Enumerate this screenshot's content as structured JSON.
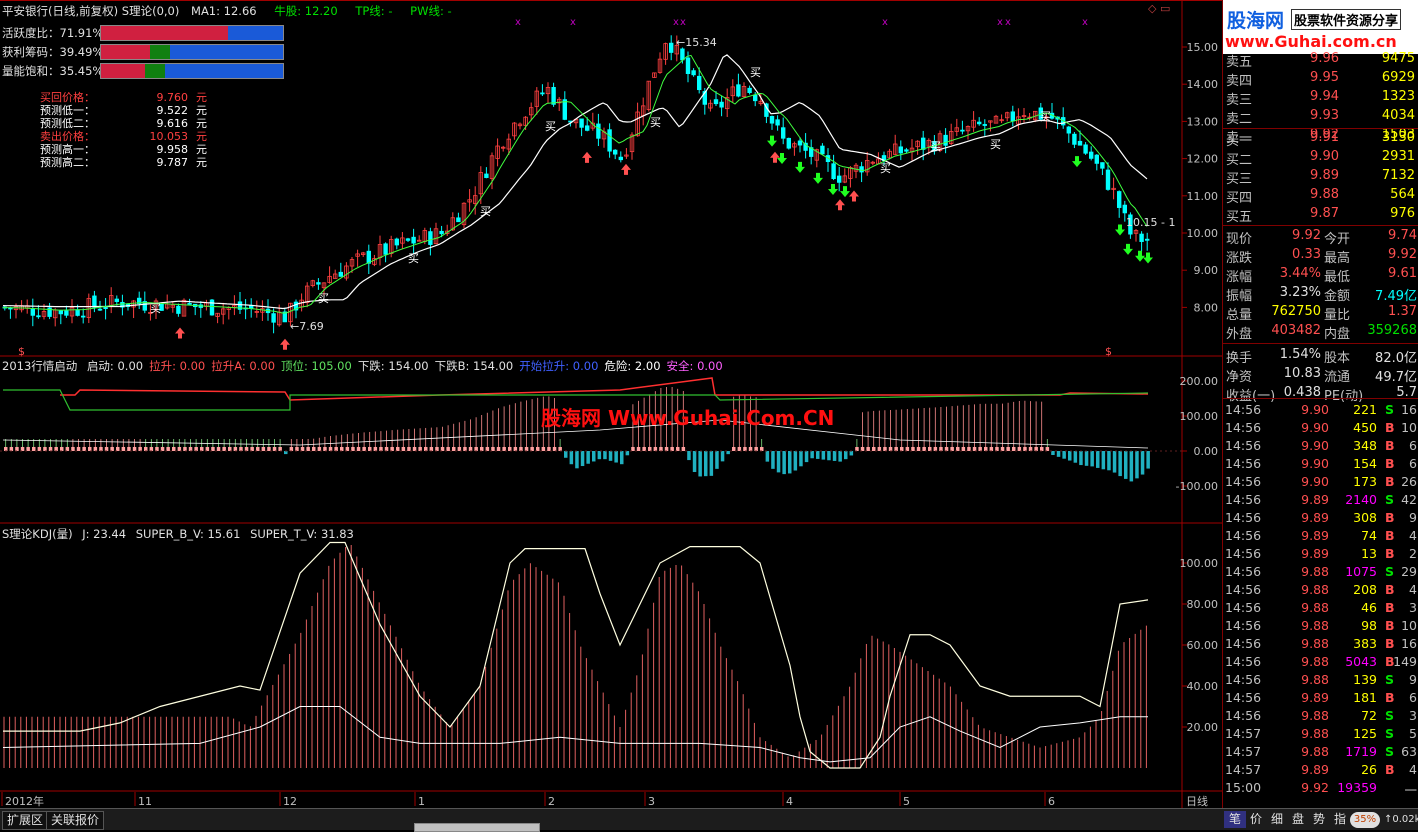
{
  "main_header": {
    "title": "平安银行(日线,前复权) S理论(0,0)",
    "ma": "MA1: 12.66",
    "niugu": "牛股: 12.20",
    "tp": "TP线: -",
    "pw": "PW线: -"
  },
  "indicators": [
    {
      "label": "活跃度比：71.91%",
      "fill": 0.7
    },
    {
      "label": "获利筹码：39.49%",
      "fill": 0.38
    },
    {
      "label": "量能饱和：35.45%",
      "fill": 0.35
    }
  ],
  "predictions": [
    {
      "label": "买回价格：",
      "value": "9.760",
      "unit": "元",
      "color": "#ff4040"
    },
    {
      "label": "预测低一：",
      "value": "9.522",
      "unit": "元",
      "color": "#ffffff"
    },
    {
      "label": "预测低二：",
      "value": "9.616",
      "unit": "元",
      "color": "#ffffff"
    },
    {
      "label": "卖出价格：",
      "value": "10.053",
      "unit": "元",
      "color": "#ff4040"
    },
    {
      "label": "预测高一：",
      "value": "9.958",
      "unit": "元",
      "color": "#ffffff"
    },
    {
      "label": "预测高二：",
      "value": "9.787",
      "unit": "元",
      "color": "#ffffff"
    }
  ],
  "main_axis": [
    "15.00",
    "14.00",
    "13.00",
    "12.00",
    "11.00",
    "10.00",
    "9.00",
    "8.00"
  ],
  "annotations": {
    "high": "15.34",
    "low": "7.69",
    "last": "10.15",
    "buy": "买",
    "sell": "$",
    "kmark": "x"
  },
  "panel2_header": {
    "name": "2013行情启动",
    "items": [
      {
        "text": "启动: 0.00",
        "color": "#e0e0e0"
      },
      {
        "text": "拉升: 0.00",
        "color": "#ff5050"
      },
      {
        "text": "拉升A: 0.00",
        "color": "#ff5050"
      },
      {
        "text": "顶位: 105.00",
        "color": "#60e060"
      },
      {
        "text": "下跌: 154.00",
        "color": "#e0e0e0"
      },
      {
        "text": "下跌B: 154.00",
        "color": "#e0e0e0"
      },
      {
        "text": "开始拉升: 0.00",
        "color": "#4060ff"
      },
      {
        "text": "危险: 2.00",
        "color": "#ffffff"
      },
      {
        "text": "安全: 0.00",
        "color": "#ff60ff"
      }
    ]
  },
  "panel2_axis": [
    "200.00",
    "100.00",
    "0.00",
    "-100.00"
  ],
  "watermark": "股海网 Www.Guhai.Com.CN",
  "panel3_header": {
    "name": "S理论KDJ(量)",
    "j": "J: 23.44",
    "b": "SUPER_B_V: 15.61",
    "t": "SUPER_T_V: 31.83"
  },
  "panel3_axis": [
    "100.00",
    "80.00",
    "60.00",
    "40.00",
    "20.00"
  ],
  "time_axis": {
    "labels": [
      "2012年",
      "11",
      "12",
      "1",
      "2",
      "3",
      "4",
      "5",
      "6"
    ],
    "period": "日线"
  },
  "logo": {
    "line1": "股海网",
    "line2": "股票软件资源分享",
    "url": "www.Guhai.com.cn"
  },
  "order_book": {
    "asks": [
      {
        "label": "卖五",
        "price": "9.96",
        "vol": "9475"
      },
      {
        "label": "卖四",
        "price": "9.95",
        "vol": "6929"
      },
      {
        "label": "卖三",
        "price": "9.94",
        "vol": "1323"
      },
      {
        "label": "卖二",
        "price": "9.93",
        "vol": "4034"
      },
      {
        "label": "卖一",
        "price": "9.92",
        "vol": "1503"
      }
    ],
    "bids": [
      {
        "label": "买一",
        "price": "9.91",
        "vol": "3130"
      },
      {
        "label": "买二",
        "price": "9.90",
        "vol": "2931"
      },
      {
        "label": "买三",
        "price": "9.89",
        "vol": "7132"
      },
      {
        "label": "买四",
        "price": "9.88",
        "vol": "564"
      },
      {
        "label": "买五",
        "price": "9.87",
        "vol": "976"
      }
    ]
  },
  "quote": [
    {
      "l1": "现价",
      "v1": "9.92",
      "c1": "#ff5050",
      "l2": "今开",
      "v2": "9.74",
      "c2": "#ff5050"
    },
    {
      "l1": "涨跌",
      "v1": "0.33",
      "c1": "#ff5050",
      "l2": "最高",
      "v2": "9.92",
      "c2": "#ff5050"
    },
    {
      "l1": "涨幅",
      "v1": "3.44%",
      "c1": "#ff5050",
      "l2": "最低",
      "v2": "9.61",
      "c2": "#ff5050"
    },
    {
      "l1": "振幅",
      "v1": "3.23%",
      "c1": "#e0e0e0",
      "l2": "金额",
      "v2": "7.49亿",
      "c2": "#00ffff"
    },
    {
      "l1": "总量",
      "v1": "762750",
      "c1": "#ffff00",
      "l2": "量比",
      "v2": "1.37",
      "c2": "#ff5050"
    },
    {
      "l1": "外盘",
      "v1": "403482",
      "c1": "#ff5050",
      "l2": "内盘",
      "v2": "359268",
      "c2": "#00e000"
    },
    {
      "l1": "换手",
      "v1": "1.54%",
      "c1": "#e0e0e0",
      "l2": "股本",
      "v2": "82.0亿",
      "c2": "#e0e0e0"
    },
    {
      "l1": "净资",
      "v1": "10.83",
      "c1": "#e0e0e0",
      "l2": "流通",
      "v2": "49.7亿",
      "c2": "#e0e0e0"
    },
    {
      "l1": "收益(一)",
      "v1": "0.438",
      "c1": "#e0e0e0",
      "l2": "PE(动)",
      "v2": "5.7",
      "c2": "#e0e0e0"
    }
  ],
  "ticks": [
    {
      "t": "14:56",
      "p": "9.90",
      "v": "221",
      "vc": "#ffff00",
      "f": "S",
      "n": "16"
    },
    {
      "t": "14:56",
      "p": "9.90",
      "v": "450",
      "vc": "#ffff00",
      "f": "B",
      "n": "10"
    },
    {
      "t": "14:56",
      "p": "9.90",
      "v": "348",
      "vc": "#ffff00",
      "f": "B",
      "n": "6"
    },
    {
      "t": "14:56",
      "p": "9.90",
      "v": "154",
      "vc": "#ffff00",
      "f": "B",
      "n": "6"
    },
    {
      "t": "14:56",
      "p": "9.90",
      "v": "173",
      "vc": "#ffff00",
      "f": "B",
      "n": "26"
    },
    {
      "t": "14:56",
      "p": "9.89",
      "v": "2140",
      "vc": "#ff00ff",
      "f": "S",
      "n": "42"
    },
    {
      "t": "14:56",
      "p": "9.89",
      "v": "308",
      "vc": "#ffff00",
      "f": "B",
      "n": "9"
    },
    {
      "t": "14:56",
      "p": "9.89",
      "v": "74",
      "vc": "#ffff00",
      "f": "B",
      "n": "4"
    },
    {
      "t": "14:56",
      "p": "9.89",
      "v": "13",
      "vc": "#ffff00",
      "f": "B",
      "n": "2"
    },
    {
      "t": "14:56",
      "p": "9.88",
      "v": "1075",
      "vc": "#ff00ff",
      "f": "S",
      "n": "29"
    },
    {
      "t": "14:56",
      "p": "9.88",
      "v": "208",
      "vc": "#ffff00",
      "f": "B",
      "n": "4"
    },
    {
      "t": "14:56",
      "p": "9.88",
      "v": "46",
      "vc": "#ffff00",
      "f": "B",
      "n": "3"
    },
    {
      "t": "14:56",
      "p": "9.88",
      "v": "98",
      "vc": "#ffff00",
      "f": "B",
      "n": "10"
    },
    {
      "t": "14:56",
      "p": "9.88",
      "v": "383",
      "vc": "#ffff00",
      "f": "B",
      "n": "16"
    },
    {
      "t": "14:56",
      "p": "9.88",
      "v": "5043",
      "vc": "#ff00ff",
      "f": "B",
      "n": "149"
    },
    {
      "t": "14:56",
      "p": "9.88",
      "v": "139",
      "vc": "#ffff00",
      "f": "S",
      "n": "9"
    },
    {
      "t": "14:56",
      "p": "9.89",
      "v": "181",
      "vc": "#ffff00",
      "f": "B",
      "n": "6"
    },
    {
      "t": "14:56",
      "p": "9.88",
      "v": "72",
      "vc": "#ffff00",
      "f": "S",
      "n": "3"
    },
    {
      "t": "14:57",
      "p": "9.88",
      "v": "125",
      "vc": "#ffff00",
      "f": "S",
      "n": "5"
    },
    {
      "t": "14:57",
      "p": "9.88",
      "v": "1719",
      "vc": "#ff00ff",
      "f": "S",
      "n": "63"
    },
    {
      "t": "14:57",
      "p": "9.89",
      "v": "26",
      "vc": "#ffff00",
      "f": "B",
      "n": "4"
    },
    {
      "t": "15:00",
      "p": "9.92",
      "v": "19359",
      "vc": "#ff00ff",
      "f": "",
      "n": "一"
    }
  ],
  "bottom_tabs": [
    "扩展区",
    "关联报价"
  ],
  "footer_tabs": [
    "笔",
    "价",
    "细",
    "盘",
    "势",
    "指"
  ],
  "status": {
    "pct": "35%",
    "speed": "0.02k"
  }
}
